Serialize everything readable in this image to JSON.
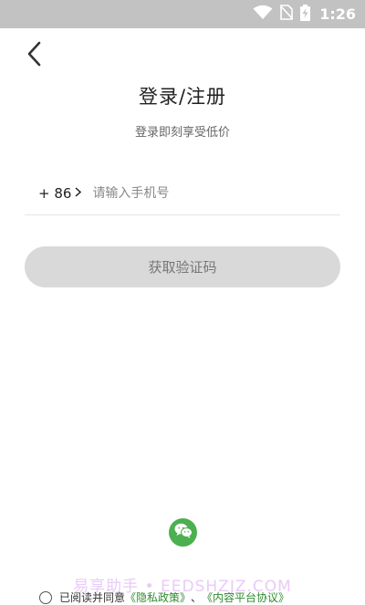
{
  "status_bar": {
    "time": "1:26",
    "icons": [
      "wifi-icon",
      "no-sim-icon",
      "battery-charging-icon"
    ]
  },
  "header": {
    "back_icon": "chevron-left-icon",
    "title": "登录/注册",
    "subtitle": "登录即刻享受低价"
  },
  "form": {
    "country_code": "+ 86",
    "country_code_icon": "chevron-right-icon",
    "phone_placeholder": "请输入手机号",
    "phone_value": "",
    "get_code_label": "获取验证码"
  },
  "social": {
    "wechat_icon": "wechat-icon"
  },
  "watermark": "易享助手 • EEDSHZJZ.COM",
  "agreement": {
    "prefix": "已阅读并同意",
    "privacy_link": "《隐私政策》",
    "separator": "、",
    "content_link": "《内容平台协议》"
  },
  "colors": {
    "status_bar_bg": "#c2c2c2",
    "button_disabled_bg": "#d9d9d9",
    "wechat_green": "#4caf50",
    "link_green": "#2e8b2e"
  }
}
